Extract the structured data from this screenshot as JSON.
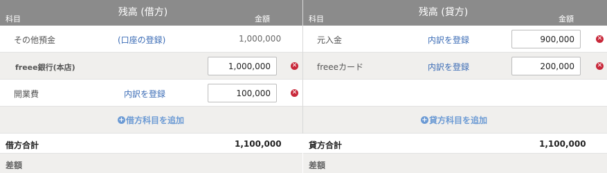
{
  "debit": {
    "title": "残高 (借方)",
    "col_account": "科目",
    "col_amount": "金額",
    "rows": [
      {
        "account": "その他預金",
        "link": "(口座の登録)",
        "amount": "1,000,000"
      },
      {
        "account": "freee銀行(本店)",
        "link": "",
        "amount": "1,000,000"
      },
      {
        "account": "開業費",
        "link": "内訳を登録",
        "amount": "100,000"
      }
    ],
    "add_label": "借方科目を追加",
    "total_label": "借方合計",
    "total_value": "1,100,000",
    "diff_label": "差額"
  },
  "credit": {
    "title": "残高 (貸方)",
    "col_account": "科目",
    "col_amount": "金額",
    "rows": [
      {
        "account": "元入金",
        "link": "内訳を登録",
        "amount": "900,000"
      },
      {
        "account": "freeeカード",
        "link": "内訳を登録",
        "amount": "200,000"
      }
    ],
    "add_label": "貸方科目を追加",
    "total_label": "貸方合計",
    "total_value": "1,100,000",
    "diff_label": "差額"
  },
  "icons": {
    "delete": "x-circle-icon",
    "add": "plus-circle-icon"
  },
  "colors": {
    "header_bg": "#8b8b8b",
    "link": "#3a6bb5",
    "add_link": "#6b9ad4",
    "delete_icon": "#c8283a"
  }
}
